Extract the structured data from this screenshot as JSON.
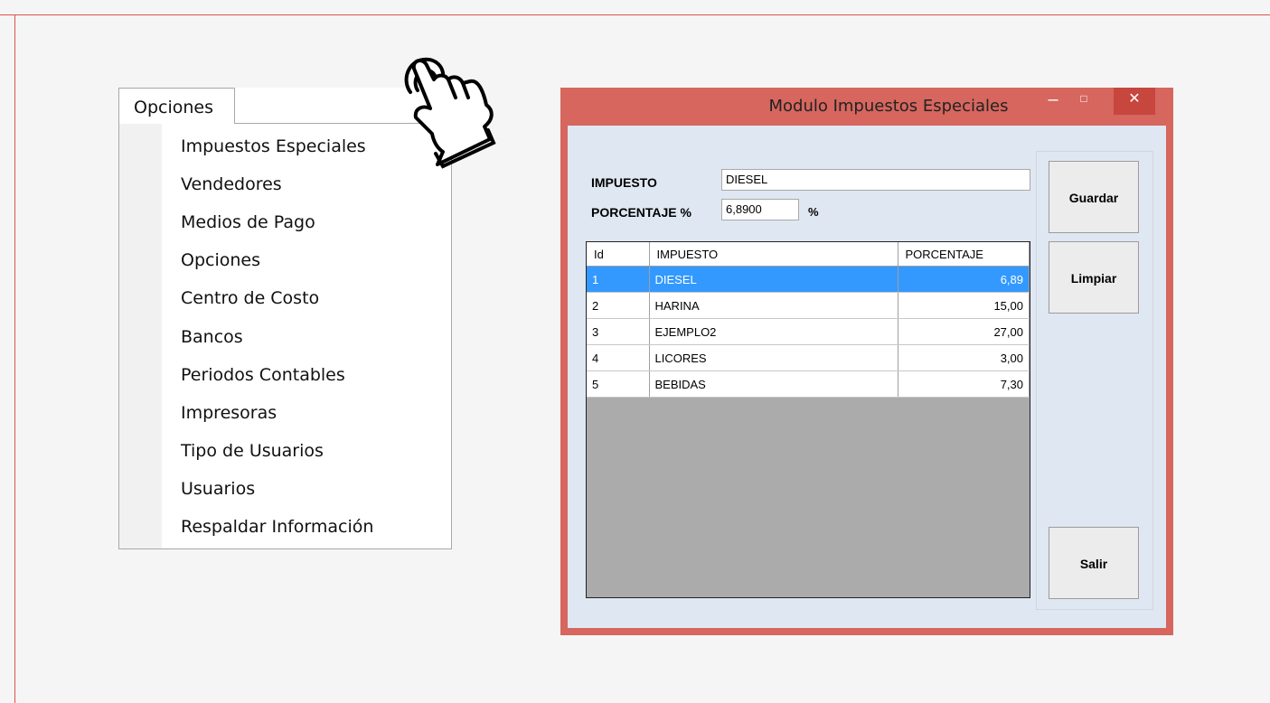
{
  "menu": {
    "tab_label": "Opciones",
    "items": [
      "Impuestos Especiales",
      "Vendedores",
      "Medios de Pago",
      "Opciones",
      "Centro de Costo",
      "Bancos",
      "Periodos Contables",
      "Impresoras",
      "Tipo de Usuarios",
      "Usuarios",
      "Respaldar Información"
    ]
  },
  "window": {
    "title": "Modulo Impuestos Especiales",
    "controls": {
      "minimize": "–",
      "maximize": "□",
      "close": "✕"
    },
    "form": {
      "impuesto_label": "IMPUESTO",
      "impuesto_value": "DIESEL",
      "porcentaje_label": "PORCENTAJE %",
      "porcentaje_value": "6,8900",
      "percent_suffix": "%"
    },
    "grid": {
      "columns": [
        "Id",
        "IMPUESTO",
        "PORCENTAJE"
      ],
      "rows": [
        {
          "id": "1",
          "impuesto": "DIESEL",
          "porcentaje": "6,89",
          "selected": true
        },
        {
          "id": "2",
          "impuesto": "HARINA",
          "porcentaje": "15,00"
        },
        {
          "id": "3",
          "impuesto": "EJEMPLO2",
          "porcentaje": "27,00"
        },
        {
          "id": "4",
          "impuesto": "LICORES",
          "porcentaje": "3,00"
        },
        {
          "id": "5",
          "impuesto": "BEBIDAS",
          "porcentaje": "7,30"
        }
      ]
    },
    "buttons": {
      "guardar": "Guardar",
      "limpiar": "Limpiar",
      "salir": "Salir"
    }
  },
  "colors": {
    "window_frame": "#d6665e",
    "client_background": "#dfe7f2",
    "selection": "#3399ff",
    "accent_line": "#d9534f"
  },
  "icons": {
    "pointer": "hand-pointer-icon"
  }
}
